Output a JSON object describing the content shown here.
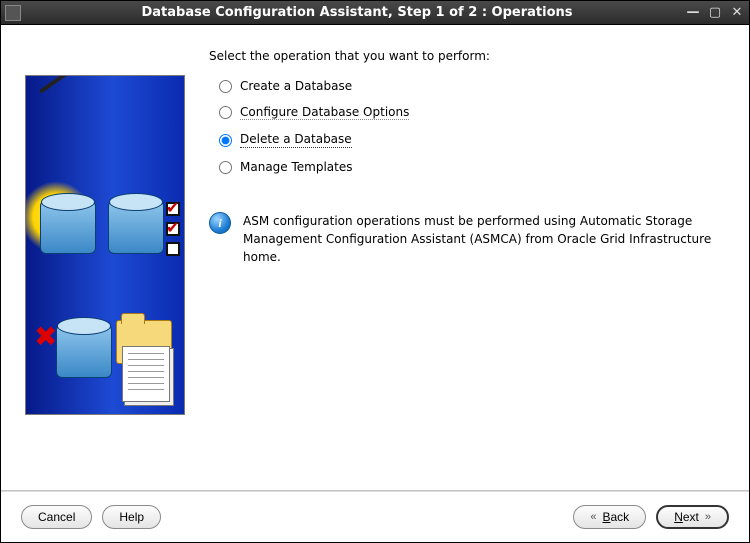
{
  "window": {
    "title": "Database Configuration Assistant, Step 1 of 2 : Operations"
  },
  "main": {
    "heading": "Select the operation that you want to perform:",
    "options": [
      {
        "label": "Create a Database",
        "selected": false,
        "enabled": true
      },
      {
        "label": "Configure Database Options",
        "selected": false,
        "enabled": false
      },
      {
        "label": "Delete a Database",
        "selected": true,
        "enabled": true
      },
      {
        "label": "Manage Templates",
        "selected": false,
        "enabled": true
      }
    ],
    "info_text": "ASM configuration operations must be performed using Automatic Storage Management Configuration Assistant (ASMCA) from Oracle Grid Infrastructure home."
  },
  "footer": {
    "cancel": "Cancel",
    "help": "Help",
    "back": "Back",
    "next": "Next"
  },
  "icons": {
    "info_glyph": "i"
  }
}
